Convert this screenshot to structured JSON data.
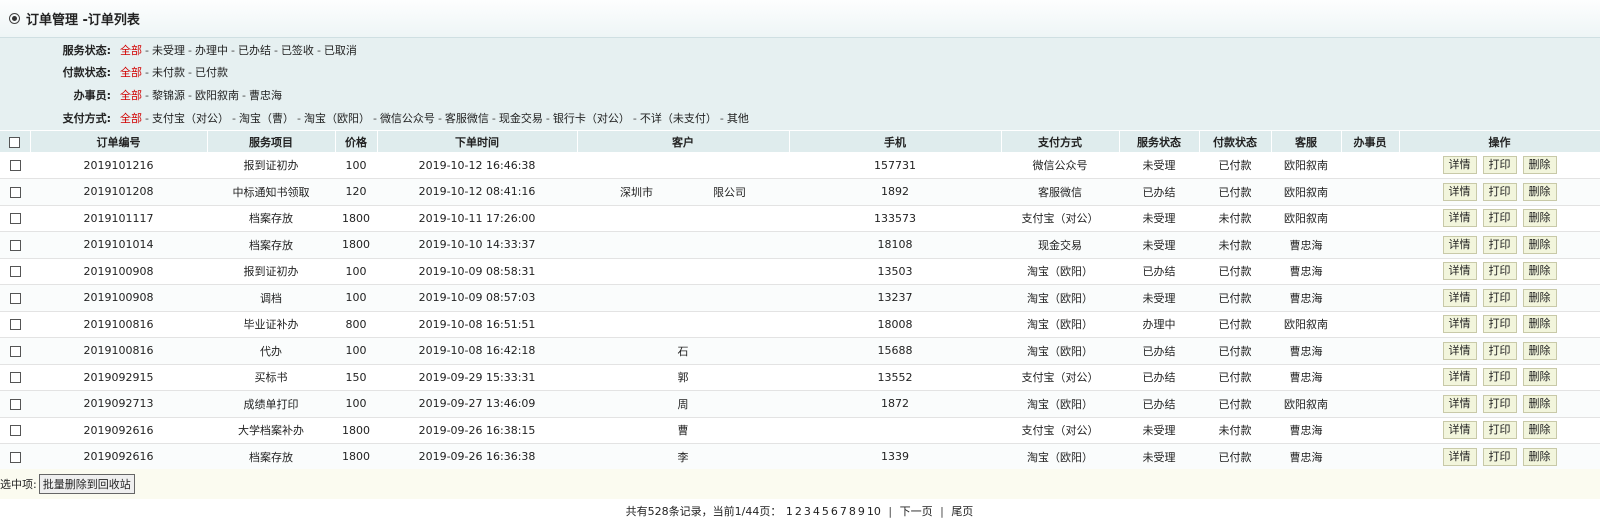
{
  "header": {
    "title": "订单管理 -订单列表"
  },
  "filters": {
    "service": {
      "label": "服务状态:",
      "options": [
        "全部",
        "未受理",
        "办理中",
        "已办结",
        "已签收",
        "已取消"
      ]
    },
    "payment": {
      "label": "付款状态:",
      "options": [
        "全部",
        "未付款",
        "已付款"
      ]
    },
    "handler": {
      "label": "办事员:",
      "options": [
        "全部",
        "黎锦源",
        "欧阳叙南",
        "曹忠海"
      ]
    },
    "paymethod": {
      "label": "支付方式:",
      "options": [
        "全部",
        "支付宝（对公）",
        "淘宝（曹）",
        "淘宝（欧阳）",
        "微信公众号",
        "客服微信",
        "现金交易",
        "银行卡（对公）",
        "不详（未支付）",
        "其他"
      ]
    }
  },
  "table": {
    "headers": [
      "订单编号",
      "服务项目",
      "价格",
      "下单时间",
      "客户",
      "手机",
      "支付方式",
      "服务状态",
      "付款状态",
      "客服",
      "办事员",
      "操作"
    ],
    "buttons": {
      "detail": "详情",
      "print": "打印",
      "delete": "删除"
    },
    "rows": [
      {
        "id": "2019101216",
        "item": "报到证初办",
        "price": "100",
        "time": "2019-10-12 16:46:38",
        "customer": "",
        "phone": "157731",
        "paymethod": "微信公众号",
        "service_status": "未受理",
        "pay_status": "已付款",
        "cs": "欧阳叙南",
        "handler": ""
      },
      {
        "id": "2019101208",
        "item": "中标通知书领取",
        "price": "120",
        "time": "2019-10-12 08:41:16",
        "customer": "深圳市",
        "customer_suffix": "限公司",
        "phone": "1892",
        "paymethod": "客服微信",
        "service_status": "已办结",
        "pay_status": "已付款",
        "cs": "欧阳叙南",
        "handler": ""
      },
      {
        "id": "2019101117",
        "item": "档案存放",
        "price": "1800",
        "time": "2019-10-11 17:26:00",
        "customer": "",
        "phone": "133573",
        "paymethod": "支付宝（对公）",
        "service_status": "未受理",
        "pay_status": "未付款",
        "cs": "欧阳叙南",
        "handler": ""
      },
      {
        "id": "2019101014",
        "item": "档案存放",
        "price": "1800",
        "time": "2019-10-10 14:33:37",
        "customer": "",
        "phone": "18108",
        "paymethod": "现金交易",
        "service_status": "未受理",
        "pay_status": "未付款",
        "cs": "曹忠海",
        "handler": ""
      },
      {
        "id": "2019100908",
        "item": "报到证初办",
        "price": "100",
        "time": "2019-10-09 08:58:31",
        "customer": "",
        "phone": "13503",
        "paymethod": "淘宝（欧阳）",
        "service_status": "已办结",
        "pay_status": "已付款",
        "cs": "曹忠海",
        "handler": ""
      },
      {
        "id": "2019100908",
        "item": "调档",
        "price": "100",
        "time": "2019-10-09 08:57:03",
        "customer": "",
        "phone": "13237",
        "paymethod": "淘宝（欧阳）",
        "service_status": "未受理",
        "pay_status": "已付款",
        "cs": "曹忠海",
        "handler": ""
      },
      {
        "id": "2019100816",
        "item": "毕业证补办",
        "price": "800",
        "time": "2019-10-08 16:51:51",
        "customer": "",
        "phone": "18008",
        "paymethod": "淘宝（欧阳）",
        "service_status": "办理中",
        "pay_status": "已付款",
        "cs": "欧阳叙南",
        "handler": ""
      },
      {
        "id": "2019100816",
        "item": "代办",
        "price": "100",
        "time": "2019-10-08 16:42:18",
        "customer": "石",
        "phone": "15688",
        "paymethod": "淘宝（欧阳）",
        "service_status": "已办结",
        "pay_status": "已付款",
        "cs": "曹忠海",
        "handler": ""
      },
      {
        "id": "2019092915",
        "item": "买标书",
        "price": "150",
        "time": "2019-09-29 15:33:31",
        "customer": "郭",
        "phone": "13552",
        "paymethod": "支付宝（对公）",
        "service_status": "已办结",
        "pay_status": "已付款",
        "cs": "曹忠海",
        "handler": ""
      },
      {
        "id": "2019092713",
        "item": "成绩单打印",
        "price": "100",
        "time": "2019-09-27 13:46:09",
        "customer": "周",
        "phone": "1872",
        "paymethod": "淘宝（欧阳）",
        "service_status": "已办结",
        "pay_status": "已付款",
        "cs": "欧阳叙南",
        "handler": ""
      },
      {
        "id": "2019092616",
        "item": "大学档案补办",
        "price": "1800",
        "time": "2019-09-26 16:38:15",
        "customer": "曹",
        "phone": "",
        "paymethod": "支付宝（对公）",
        "service_status": "未受理",
        "pay_status": "未付款",
        "cs": "曹忠海",
        "handler": ""
      },
      {
        "id": "2019092616",
        "item": "档案存放",
        "price": "1800",
        "time": "2019-09-26 16:36:38",
        "customer": "李",
        "phone": "1339",
        "paymethod": "淘宝（欧阳）",
        "service_status": "未受理",
        "pay_status": "已付款",
        "cs": "曹忠海",
        "handler": ""
      }
    ]
  },
  "batch": {
    "label": "选中项:",
    "button": "批量删除到回收站"
  },
  "pager": {
    "summary": "共有528条记录，当前1/44页：",
    "pages": [
      "1",
      "2",
      "3",
      "4",
      "5",
      "6",
      "7",
      "8",
      "9",
      "10"
    ],
    "next": "下一页",
    "last": "尾页"
  },
  "colors": {
    "accent_red": "#d10000",
    "green": "#008000",
    "blue": "#00008b",
    "filter_bg": "#e6f0f1"
  }
}
